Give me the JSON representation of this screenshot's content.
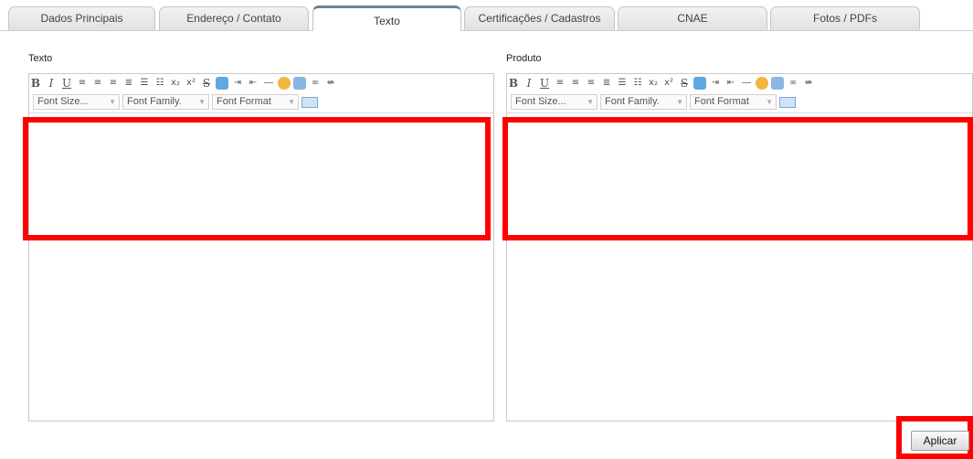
{
  "tabs": [
    {
      "label": "Dados Principais",
      "active": false
    },
    {
      "label": "Endereço / Contato",
      "active": false
    },
    {
      "label": "Texto",
      "active": true
    },
    {
      "label": "Certificações / Cadastros",
      "active": false
    },
    {
      "label": "CNAE",
      "active": false
    },
    {
      "label": "Fotos / PDFs",
      "active": false
    }
  ],
  "editors": {
    "texto": {
      "label": "Texto"
    },
    "produto": {
      "label": "Produto"
    }
  },
  "toolbar": {
    "bold": "B",
    "italic": "I",
    "underline": "U",
    "subscript": "x₂",
    "superscript": "x²",
    "strike": "S",
    "font_size": "Font Size...",
    "font_family": "Font Family.",
    "font_format": "Font Format"
  },
  "actions": {
    "apply_label": "Aplicar"
  },
  "colors": {
    "highlight": "#ff0000",
    "active_tab_top": "#6d8294"
  }
}
